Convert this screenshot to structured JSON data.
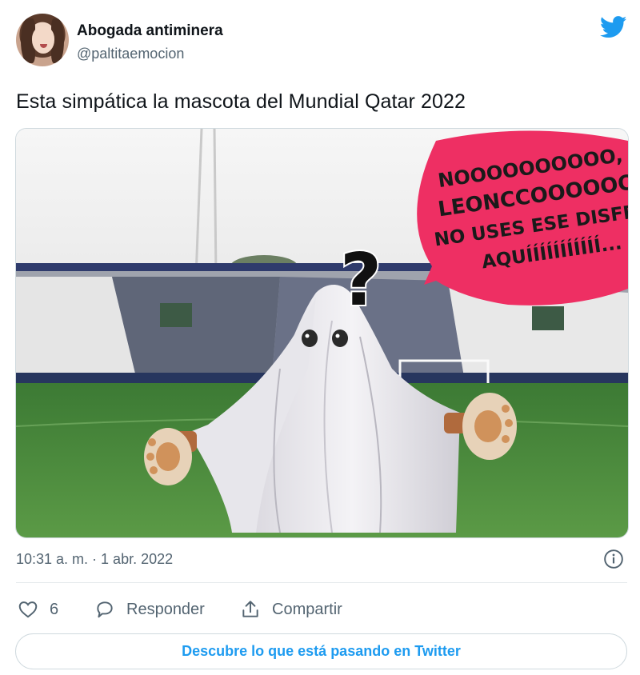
{
  "author": {
    "name": "Abogada antiminera",
    "handle": "@paltitaemocion",
    "avatar_icon": "avatar-photo"
  },
  "brand": {
    "logo": "twitter-bird-icon",
    "color": "#1d9bf0"
  },
  "tweet": {
    "text": "Esta simpática la mascota del Mundial Qatar 2022",
    "timestamp": "10:31 a. m. · 1 abr. 2022"
  },
  "media": {
    "speech_bubble_lines": [
      "NOOOOOOOOOO,",
      "LEONCCOOOOOOO",
      "NO USES ESE DISFR",
      "AQUÍÍÍÍÍÍÍÍÍÍÍ..."
    ],
    "question_mark": "?",
    "bubble_color": "#ee2f63"
  },
  "actions": {
    "like_count": "6",
    "reply_label": "Responder",
    "share_label": "Compartir"
  },
  "cta": {
    "label": "Descubre lo que está pasando en Twitter"
  }
}
